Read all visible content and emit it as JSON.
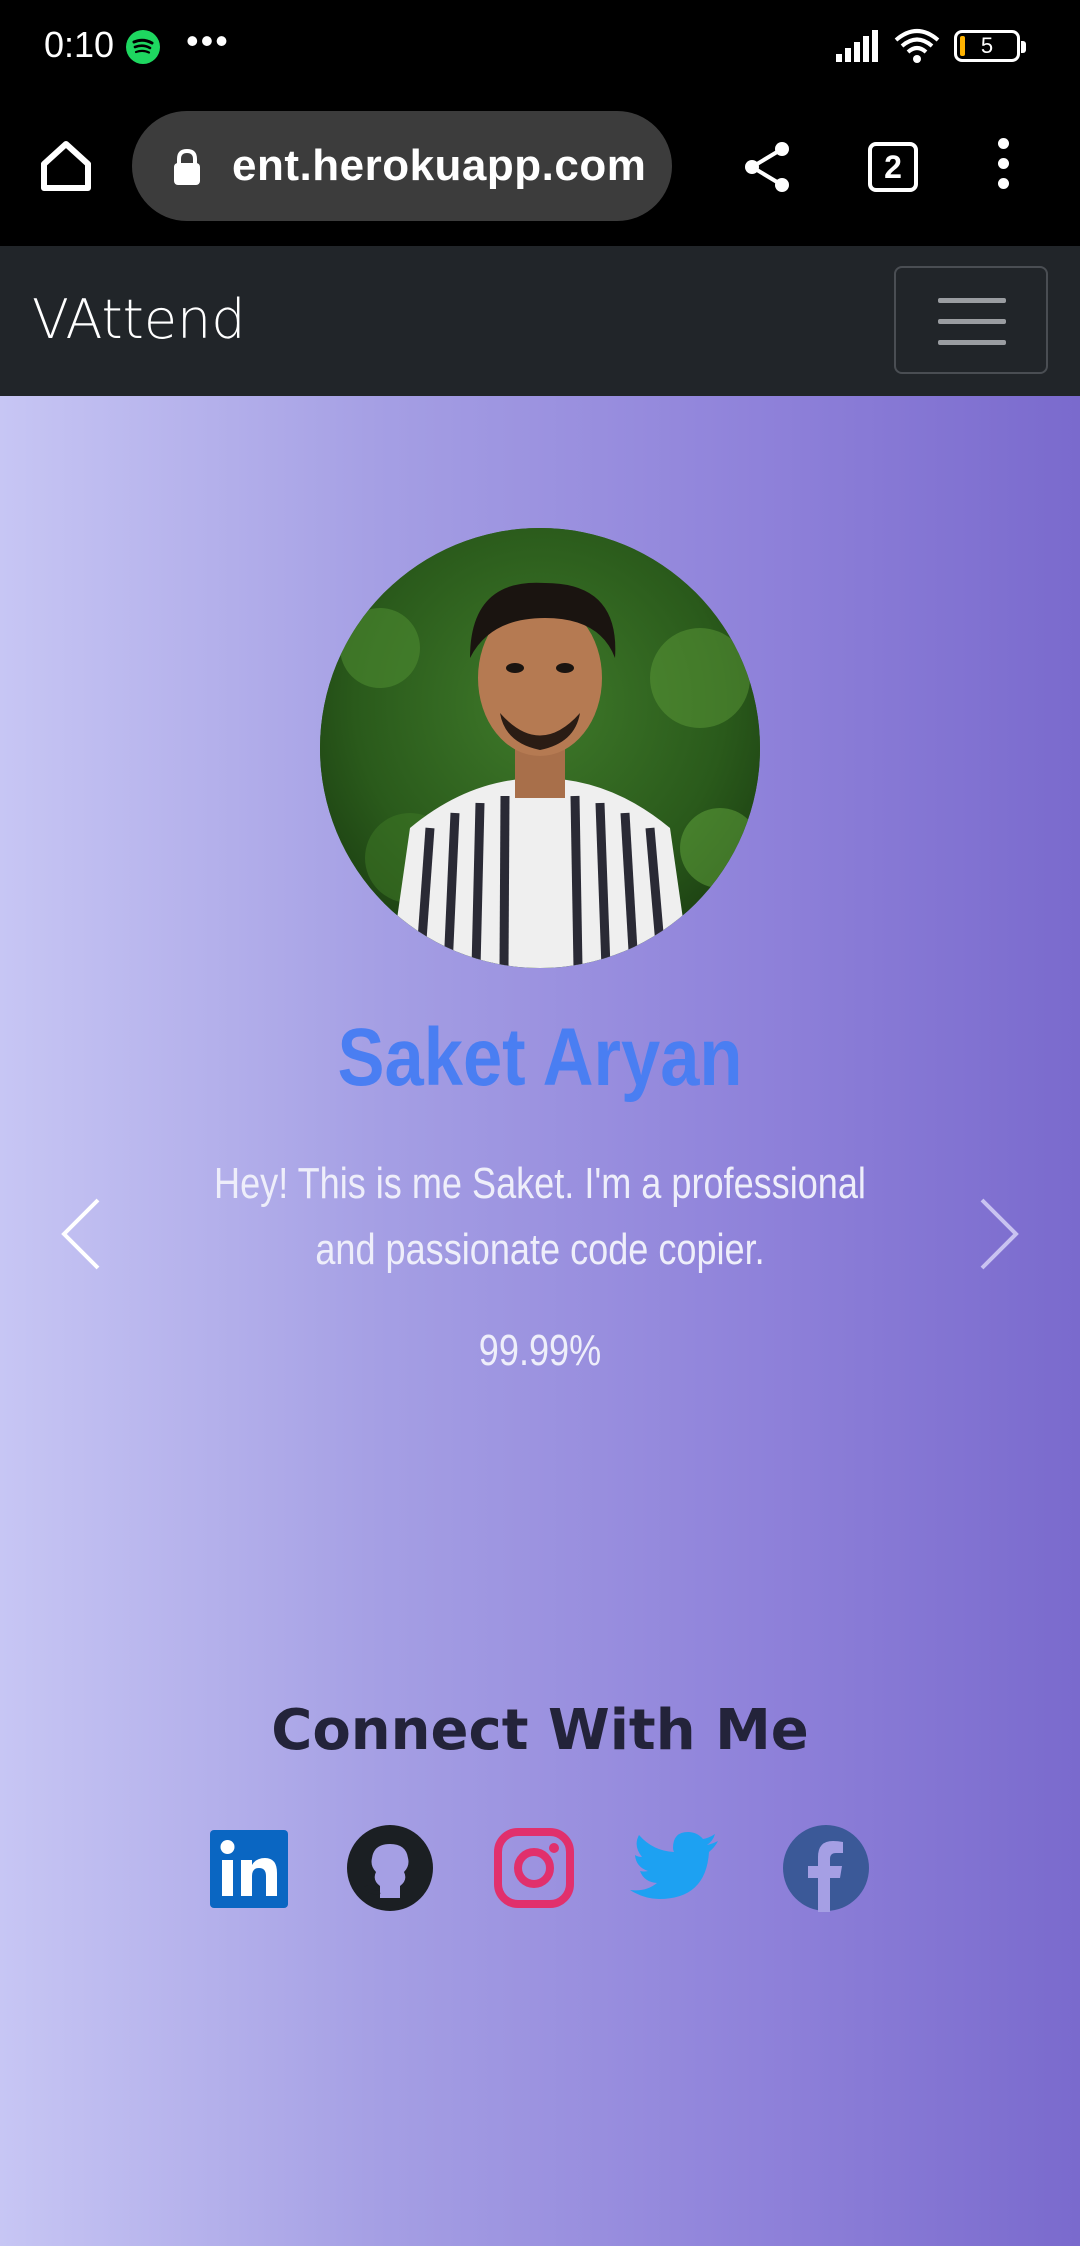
{
  "status_bar": {
    "time": "0:10",
    "battery_level": "5",
    "icons": [
      "spotify-icon",
      "more-dots-icon",
      "signal-icon",
      "wifi-icon",
      "battery-icon"
    ]
  },
  "browser": {
    "url": "ent.herokuapp.com",
    "tab_count": "2"
  },
  "navbar": {
    "brand": "VAttend"
  },
  "profile": {
    "name": "Saket Aryan",
    "bio": "Hey! This is me Saket. I'm a professional and passionate code copier.",
    "percent": "99.99%"
  },
  "connect": {
    "heading": "Connect With Me",
    "socials": [
      "linkedin-icon",
      "github-icon",
      "instagram-icon",
      "twitter-icon",
      "facebook-icon"
    ]
  },
  "colors": {
    "name": "#4a7ef2",
    "linkedin": "#0a66c2",
    "instagram": "#e1306c",
    "twitter": "#1da1f2",
    "facebook": "#3b5998"
  }
}
